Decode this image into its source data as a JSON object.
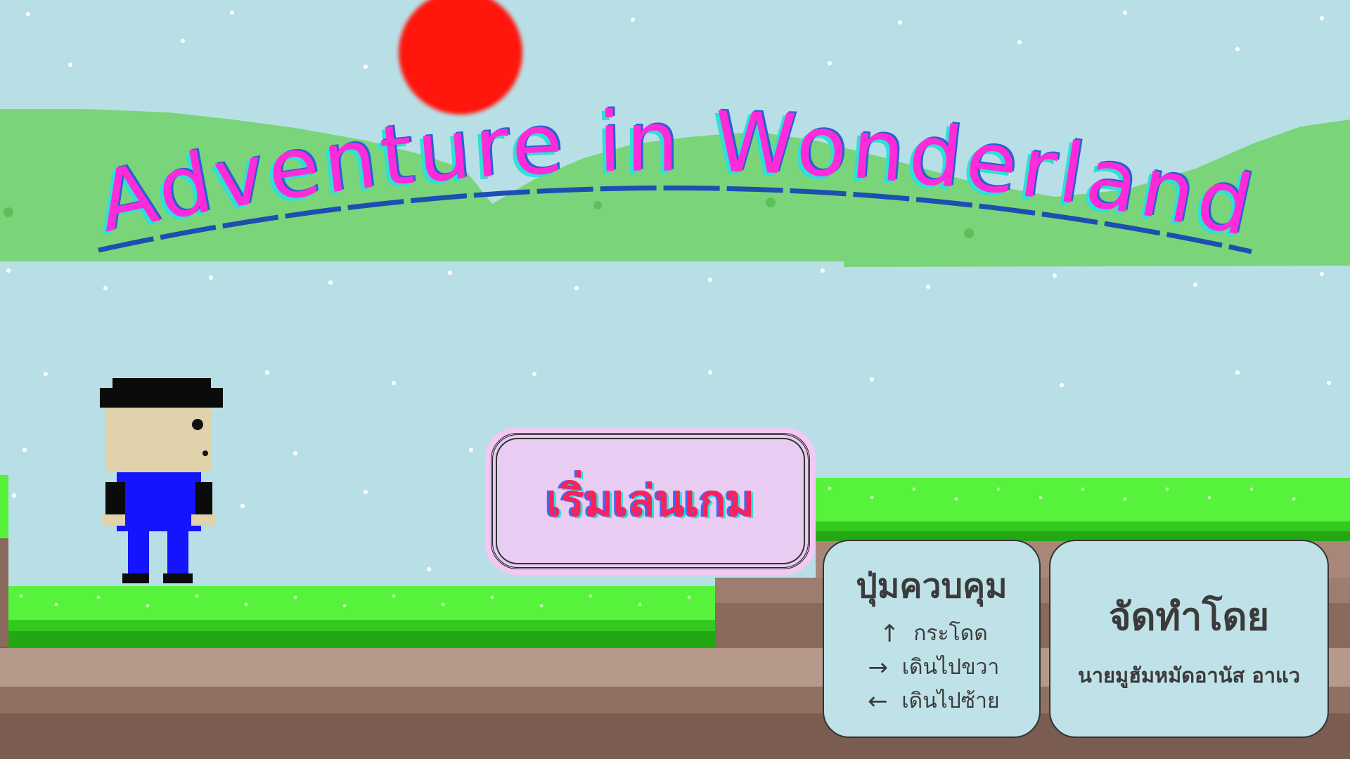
{
  "game": {
    "title": "Adventure in Wonderland"
  },
  "menu": {
    "start_label": "เริ่มเล่นเกม"
  },
  "controls": {
    "title": "ปุ่มควบคุม",
    "items": [
      {
        "icon": "arrow-up-icon",
        "glyph": "↑",
        "label": "กระโดด"
      },
      {
        "icon": "arrow-right-icon",
        "glyph": "→",
        "label": "เดินไปขวา"
      },
      {
        "icon": "arrow-left-icon",
        "glyph": "←",
        "label": "เดินไปซ้าย"
      }
    ]
  },
  "credits": {
    "title": "จัดทำโดย",
    "author": "นายมูฮัมหมัดอานัส อาแว"
  },
  "colors": {
    "sky": "#b9dfe6",
    "sun": "#ff1408",
    "hills": "#7ad57a",
    "grass": "#56f23c",
    "dirt": "#8a6a5c",
    "title_main": "#ff2bd8",
    "title_shadow": "#2ee0d6",
    "title_underline": "#1b4fb0",
    "start_text": "#ff1f5a"
  }
}
